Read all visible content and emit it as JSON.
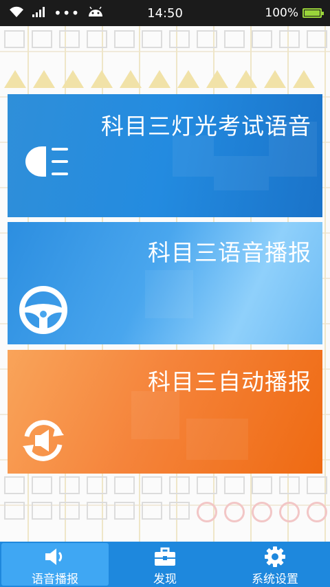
{
  "status_bar": {
    "time": "14:50",
    "battery": "100%",
    "icons": [
      "wifi-icon",
      "signal-icon",
      "more-dots-icon",
      "android-icon",
      "battery-icon"
    ]
  },
  "cards": [
    {
      "title": "科目三灯光考试语音",
      "icon": "headlight-icon",
      "color": "#238be0"
    },
    {
      "title": "科目三语音播报",
      "icon": "steering-wheel-icon",
      "color": "#49a6ee"
    },
    {
      "title": "科目三自动播报",
      "icon": "auto-play-cycle-icon",
      "color": "#f5843b"
    }
  ],
  "bottom_nav": {
    "items": [
      {
        "label": "语音播报",
        "icon": "speaker-icon",
        "active": true
      },
      {
        "label": "发现",
        "icon": "briefcase-icon",
        "active": false
      },
      {
        "label": "系统设置",
        "icon": "gear-icon",
        "active": false
      }
    ],
    "color": "#1e88dd"
  }
}
